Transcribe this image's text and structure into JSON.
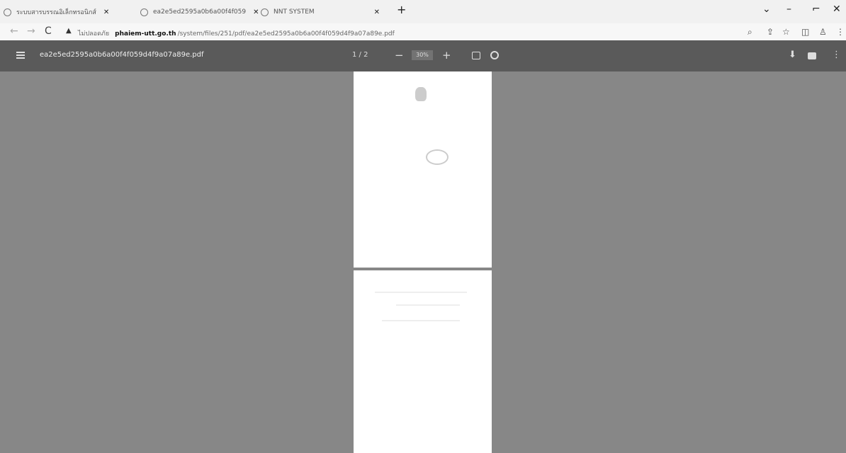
{
  "tabs": [
    {
      "title": "ระบบสารบรรณอิเล็กทรอนิกส์"
    },
    {
      "title": "ea2e5ed2595a0b6a00f4f059"
    },
    {
      "title": "NNT SYSTEM"
    }
  ],
  "newtab_label": "+",
  "window_controls": {
    "chevron": "⌄",
    "minimize": "–",
    "restore": "⌐",
    "close": "✕"
  },
  "addressbar": {
    "security_warning": "ไม่ปลอดภัย",
    "url_host": "phaiem-utt.go.th",
    "url_path": "/system/files/251/pdf/ea2e5ed2595a0b6a00f4f059d4f9a07a89e.pdf"
  },
  "pdf_toolbar": {
    "filename": "ea2e5ed2595a0b6a00f4f059d4f9a07a89e.pdf",
    "page_indicator": "1 / 2",
    "zoom_out": "−",
    "zoom_value": "30%",
    "zoom_in": "+",
    "download": "⬇",
    "more": "⋮"
  },
  "icons": {
    "back": "←",
    "forward": "→",
    "reload": "C",
    "warning": "▲",
    "zoom": "⌕",
    "share": "⇪",
    "bookmark": "☆",
    "sidepanel": "◫",
    "profile": "♙",
    "menu": "⋮"
  }
}
